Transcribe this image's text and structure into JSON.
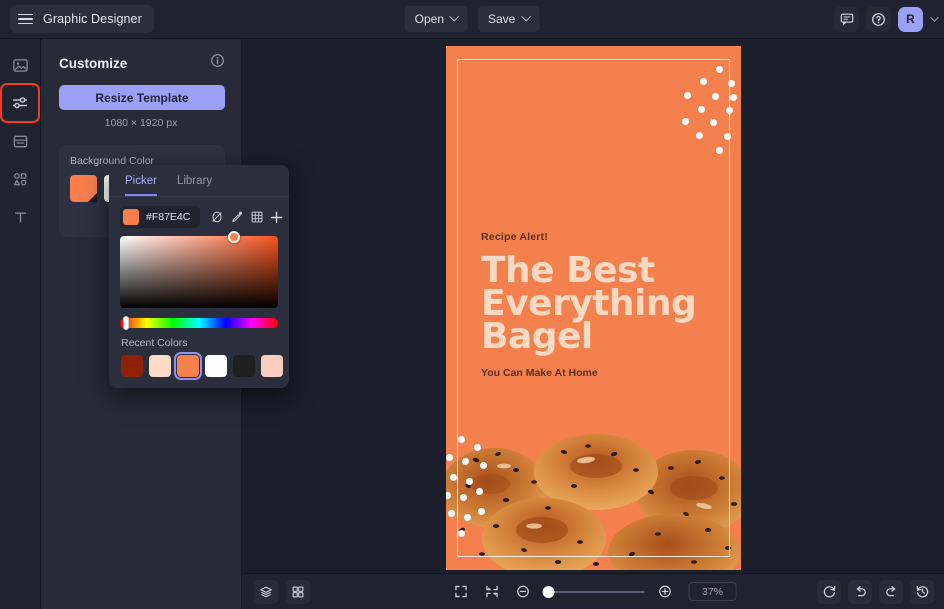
{
  "topbar": {
    "menu_icon": "hamburger-icon",
    "title": "Graphic Designer",
    "open_label": "Open",
    "save_label": "Save",
    "comment_icon": "comment-icon",
    "help_icon": "help-circle-icon",
    "avatar_initial": "R",
    "accent": "#9aa0f5"
  },
  "rail": {
    "items": [
      {
        "icon": "image-icon",
        "active": false
      },
      {
        "icon": "sliders-icon",
        "active": true
      },
      {
        "icon": "layout-icon",
        "active": false
      },
      {
        "icon": "shapes-icon",
        "active": false
      },
      {
        "icon": "text-icon",
        "active": false
      }
    ],
    "highlight_color": "#f33b23"
  },
  "panel": {
    "title": "Customize",
    "info_icon": "info-icon",
    "resize_label": "Resize Template",
    "dimensions": "1080 × 1920 px",
    "background": {
      "label": "Background Color",
      "swatches": [
        {
          "name": "orange",
          "hex": "#F87E4C",
          "selected": true
        },
        {
          "name": "white",
          "hex": "#FFFFFF",
          "selected": false
        },
        {
          "name": "crimson",
          "hex": "#C41237",
          "selected": false
        },
        {
          "name": "gold",
          "hex": "#D8A318",
          "selected": false
        }
      ]
    }
  },
  "picker": {
    "tabs": [
      {
        "label": "Picker",
        "active": true
      },
      {
        "label": "Library",
        "active": false
      }
    ],
    "hex_value": "#F87E4C",
    "swatch_hex": "#F87E4C",
    "tools": [
      {
        "icon": "no-color-icon"
      },
      {
        "icon": "eyedropper-icon"
      },
      {
        "icon": "grid-icon"
      },
      {
        "icon": "plus-icon"
      }
    ],
    "recent_label": "Recent Colors",
    "recent_colors": [
      {
        "hex": "#8F2206",
        "selected": false
      },
      {
        "hex": "#FBDBC6",
        "selected": false
      },
      {
        "hex": "#F4804E",
        "selected": true
      },
      {
        "hex": "#FFFFFF",
        "selected": false
      },
      {
        "hex": "#201F1F",
        "selected": false
      },
      {
        "hex": "#FACDBE",
        "selected": false
      }
    ]
  },
  "artboard": {
    "background_hex": "#F4804E",
    "kicker": "Recipe Alert!",
    "headline_line1": "The Best",
    "headline_line2": "Everything",
    "headline_line3": "Bagel",
    "subline": "You Can Make At Home",
    "headline_color": "#FCD9C2",
    "text_color": "#5E2F1C",
    "image_alt": "bagels-illustration"
  },
  "bottombar": {
    "layers_icon": "layers-icon",
    "grid_icon": "grid-view-icon",
    "fit_icon": "fit-screen-icon",
    "shrink_icon": "collapse-icon",
    "zoom_out_icon": "zoom-out-icon",
    "zoom_in_icon": "zoom-in-icon",
    "zoom_value": "37%",
    "zoom_slider_percent": 0,
    "reset_icon": "refresh-icon",
    "undo_icon": "undo-icon",
    "redo_icon": "redo-icon",
    "history_icon": "history-icon"
  }
}
